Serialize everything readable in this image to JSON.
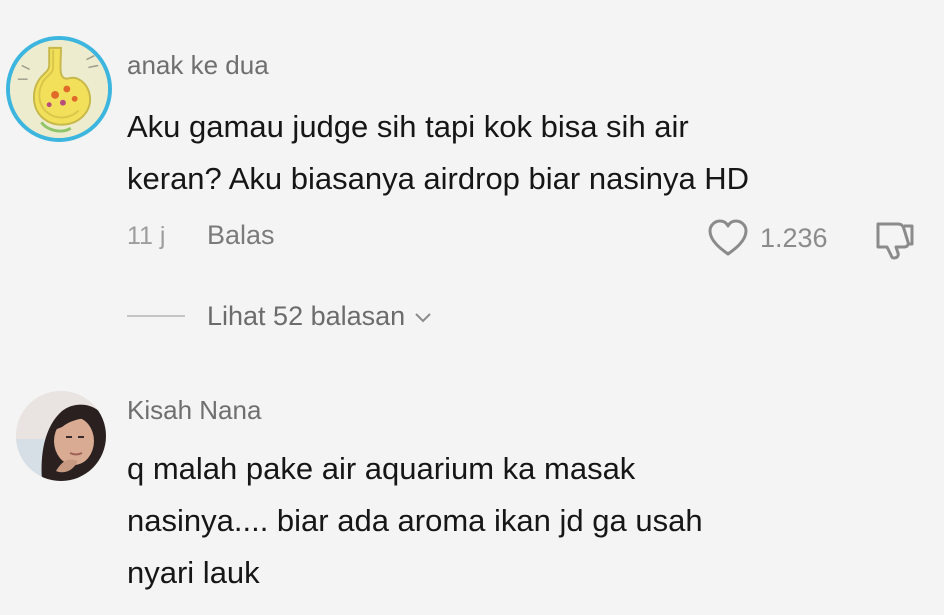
{
  "comments": [
    {
      "username": "anak ke dua",
      "text_lines": [
        "Aku gamau judge sih tapi kok bisa sih air",
        "keran? Aku biasanya airdrop biar nasinya HD"
      ],
      "timestamp": "11 j",
      "reply_label": "Balas",
      "like_count": "1.236",
      "view_replies_label": "Lihat 52 balasan",
      "avatar_icon": "stomach-cartoon-icon",
      "avatar_ring_color": "#3db6df"
    },
    {
      "username": "Kisah Nana",
      "text_lines": [
        "q malah pake air aquarium ka masak",
        "nasinya.... biar ada aroma ikan jd ga usah",
        "nyari lauk"
      ],
      "avatar_icon": "user-photo-avatar"
    }
  ],
  "icons": {
    "like": "heart-icon",
    "dislike": "thumbs-down-icon",
    "expand": "chevron-down-icon"
  },
  "colors": {
    "background": "#f4f4f4",
    "text": "#161616",
    "username": "#6f6f6f",
    "meta": "#9d9d9d"
  }
}
